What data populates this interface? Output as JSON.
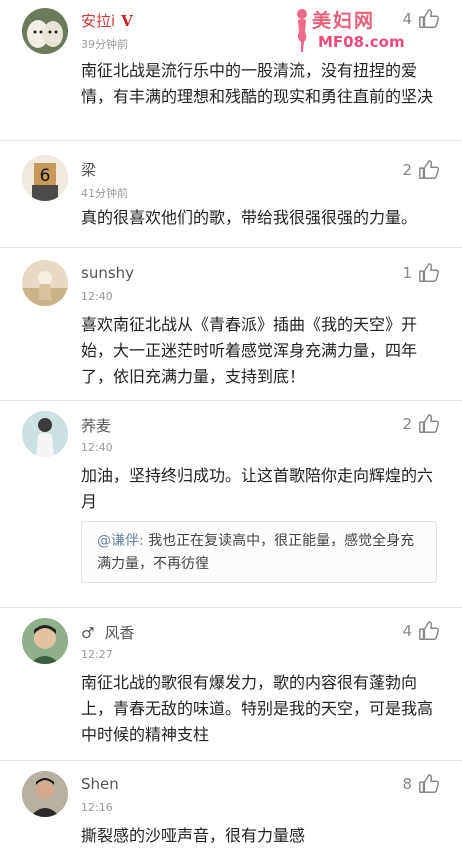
{
  "watermark": {
    "title": "美妇网",
    "url": "MF08.com"
  },
  "comments": [
    {
      "name": "安拉i",
      "badge": "V",
      "time": "39分钟前",
      "likes": "4",
      "text": "南征北战是流行乐中的一股清流，没有扭捏的爱情，有丰满的理想和残酷的现实和勇往直前的坚决"
    },
    {
      "name": "梁",
      "time": "41分钟前",
      "likes": "2",
      "text": "真的很喜欢他们的歌，带给我很强很强的力量。"
    },
    {
      "name": "sunshy",
      "time": "12:40",
      "likes": "1",
      "text": "喜欢南征北战从《青春派》插曲《我的天空》开始，大一正迷茫时听着感觉浑身充满力量，四年了，依旧充满力量，支持到底！"
    },
    {
      "name": "荞麦",
      "time": "12:40",
      "likes": "2",
      "text": "加油，坚持终归成功。让这首歌陪你走向辉煌的六月",
      "reply": {
        "replier": "@谦伴:",
        "text": " 我也正在复读高中，很正能量，感觉全身充满力量，不再彷徨"
      }
    },
    {
      "name": "风香",
      "gender": "♂",
      "time": "12:27",
      "likes": "4",
      "text": "南征北战的歌很有爆发力，歌的内容很有蓬勃向上，青春无敌的味道。特别是我的天空，可是我高中时候的精神支柱"
    },
    {
      "name": "Shen",
      "time": "12:16",
      "likes": "8",
      "text": "撕裂感的沙哑声音，很有力量感"
    }
  ],
  "icons": {
    "like": "thumbs-up-icon",
    "gender": "male-icon",
    "verified": "verified-v-icon"
  }
}
